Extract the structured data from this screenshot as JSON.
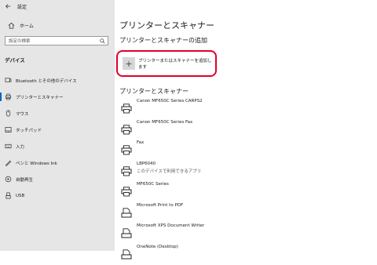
{
  "window": {
    "title": "設定"
  },
  "sidebar": {
    "home_label": "ホーム",
    "search_placeholder": "設定の検索",
    "section_title": "デバイス",
    "items": [
      {
        "label": "Bluetooth とその他のデバイス",
        "icon": "bluetooth-icon"
      },
      {
        "label": "プリンターとスキャナー",
        "icon": "printer-icon",
        "active": true
      },
      {
        "label": "マウス",
        "icon": "mouse-icon"
      },
      {
        "label": "タッチパッド",
        "icon": "touchpad-icon"
      },
      {
        "label": "入力",
        "icon": "keyboard-icon"
      },
      {
        "label": "ペンと Windows Ink",
        "icon": "pen-icon"
      },
      {
        "label": "自動再生",
        "icon": "autoplay-icon"
      },
      {
        "label": "USB",
        "icon": "usb-icon"
      }
    ]
  },
  "main": {
    "title": "プリンターとスキャナー",
    "add_section_title": "プリンターとスキャナーの追加",
    "add_button_label": "プリンターまたはスキャナーを追加します",
    "list_section_title": "プリンターとスキャナー",
    "devices": [
      {
        "name": "Canon MF650C Series CARPS2",
        "sub": "",
        "icon": "printer-icon"
      },
      {
        "name": "Canon MF650C Series Fax",
        "sub": "",
        "icon": "printer-icon"
      },
      {
        "name": "Fax",
        "sub": "",
        "icon": "printer-icon"
      },
      {
        "name": "LBP6040",
        "sub": "このデバイスで利用できるアプリ",
        "icon": "printer-icon"
      },
      {
        "name": "MF650C Series",
        "sub": "",
        "icon": "printer-icon"
      },
      {
        "name": "Microsoft Print to PDF",
        "sub": "",
        "icon": "document-printer-icon"
      },
      {
        "name": "Microsoft XPS Document Writer",
        "sub": "",
        "icon": "document-printer-icon"
      },
      {
        "name": "OneNote (Desktop)",
        "sub": "",
        "icon": "document-printer-icon"
      }
    ]
  },
  "colors": {
    "highlight": "#e2002a",
    "accent": "#0067c0",
    "sidebar_bg": "#e6e6e6"
  }
}
